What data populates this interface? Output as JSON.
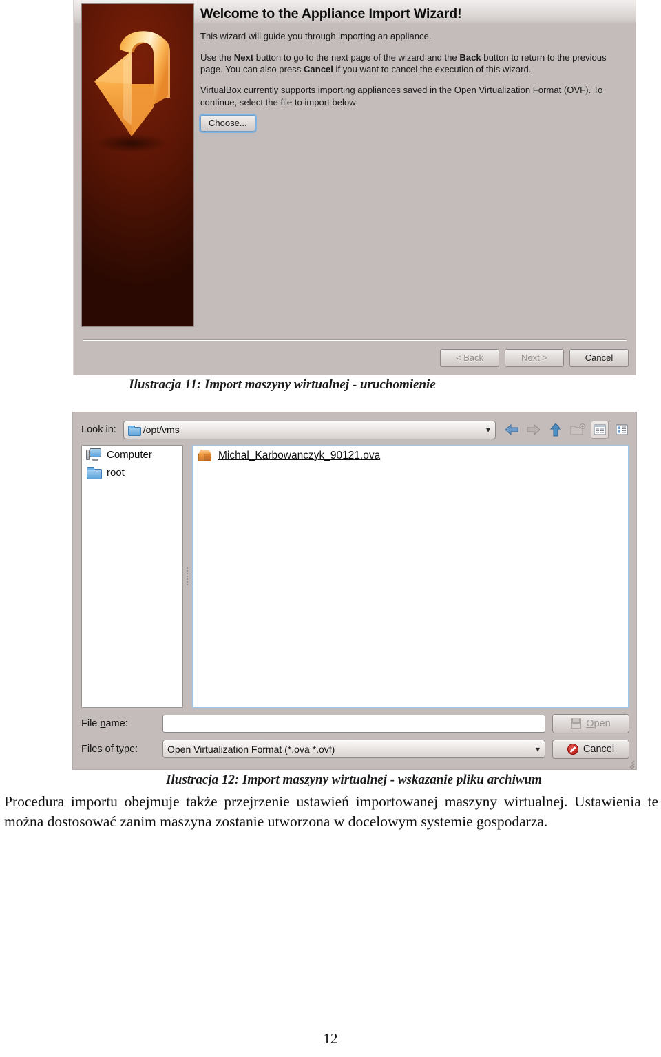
{
  "figure1": {
    "title": "Welcome to the Appliance Import Wizard!",
    "paragraph1": "This wizard will guide you through importing an appliance.",
    "paragraph2_parts": {
      "a": "Use the ",
      "b1": "Next",
      "c": " button to go to the next page of the wizard and the ",
      "b2": "Back",
      "d": " button to return to the previous page. You can also press ",
      "b3": "Cancel",
      "e": " if you want to cancel the execution of this wizard."
    },
    "paragraph3": "VirtualBox currently supports importing appliances saved in the Open Virtualization Format (OVF). To continue, select the file to import below:",
    "choose_button": "Choose...",
    "buttons": {
      "back": "< Back",
      "next": "Next >",
      "cancel": "Cancel"
    },
    "side_image_alt": "orange-down-arrow-graphic"
  },
  "caption1": "Ilustracja 11: Import maszyny wirtualnej - uruchomienie",
  "figure2": {
    "look_in_label": "Look in:",
    "look_in_value": "/opt/vms",
    "toolbar": [
      {
        "name": "back-arrow-icon",
        "state": "enabled"
      },
      {
        "name": "forward-arrow-icon",
        "state": "disabled"
      },
      {
        "name": "parent-directory-icon",
        "state": "enabled"
      },
      {
        "name": "new-folder-icon",
        "state": "disabled"
      },
      {
        "name": "list-view-icon",
        "state": "active"
      },
      {
        "name": "detail-view-icon",
        "state": "enabled"
      }
    ],
    "sidebar": [
      {
        "label": "Computer",
        "icon": "computer-icon"
      },
      {
        "label": "root",
        "icon": "folder-icon"
      }
    ],
    "files": [
      {
        "label": "Michal_Karbowanczyk_90121.ova",
        "icon": "ova-package-icon"
      }
    ],
    "file_name_label_pre": "File ",
    "file_name_label_underlined": "n",
    "file_name_label_post": "ame:",
    "file_name_value": "",
    "file_name_placeholder": "",
    "files_of_type_label": "Files of type:",
    "files_of_type_value": "Open Virtualization Format (*.ova *.ovf)",
    "open_button_pre": "",
    "open_button_underlined": "O",
    "open_button_post": "pen",
    "cancel_button": "Cancel"
  },
  "caption2": "Ilustracja 12: Import maszyny wirtualnej - wskazanie pliku archiwum",
  "body_text": "Procedura importu obejmuje także przejrzenie ustawień importowanej maszyny wirtualnej. Ustawienia te można dostosować zanim maszyna zostanie utworzona w docelowym systemie gospodarza.",
  "page_number": "12",
  "colors": {
    "dialog_bg": "#c3bcba",
    "focus_blue": "#9fc6e6",
    "accent_orange": "#f0a047",
    "image_red": "#5c1605"
  }
}
